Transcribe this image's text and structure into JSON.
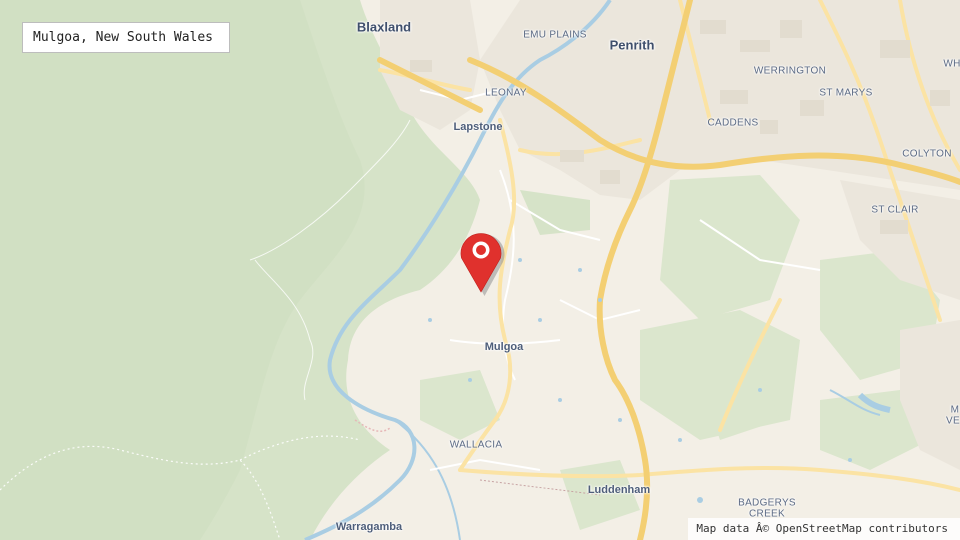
{
  "location": {
    "name": "Mulgoa, New South Wales"
  },
  "map": {
    "colors": {
      "forest": "#d7e3c9",
      "forest_dark": "#cbdcbc",
      "land": "#f3efe6",
      "urban": "#ebe6dc",
      "motorway": "#f5d98a",
      "road": "#fbe8ad",
      "water": "#a9cde3",
      "marker": "#e0312d"
    },
    "places": [
      {
        "id": "blaxland",
        "label": "Blaxland",
        "kind": "major"
      },
      {
        "id": "penrith",
        "label": "Penrith",
        "kind": "major"
      },
      {
        "id": "emu-plains",
        "label": "EMU PLAINS",
        "kind": "suburb"
      },
      {
        "id": "leonay",
        "label": "LEONAY",
        "kind": "suburb"
      },
      {
        "id": "lapstone",
        "label": "Lapstone",
        "kind": "town"
      },
      {
        "id": "werrington",
        "label": "WERRINGTON",
        "kind": "suburb"
      },
      {
        "id": "st-marys",
        "label": "ST MARYS",
        "kind": "suburb"
      },
      {
        "id": "caddens",
        "label": "CADDENS",
        "kind": "suburb"
      },
      {
        "id": "colyton",
        "label": "COLYTON",
        "kind": "suburb"
      },
      {
        "id": "st-clair",
        "label": "ST CLAIR",
        "kind": "suburb"
      },
      {
        "id": "mulgoa",
        "label": "Mulgoa",
        "kind": "town"
      },
      {
        "id": "wallacia",
        "label": "WALLACIA",
        "kind": "suburb"
      },
      {
        "id": "luddenham",
        "label": "Luddenham",
        "kind": "town"
      },
      {
        "id": "warragamba",
        "label": "Warragamba",
        "kind": "town"
      },
      {
        "id": "badgerys-creek-1",
        "label": "BADGERYS",
        "kind": "suburb"
      },
      {
        "id": "badgerys-creek-2",
        "label": "CREEK",
        "kind": "suburb"
      },
      {
        "id": "edge-wh",
        "label": "WH",
        "kind": "suburb"
      },
      {
        "id": "edge-m",
        "label": "M",
        "kind": "suburb"
      },
      {
        "id": "edge-ve",
        "label": "VE",
        "kind": "suburb"
      }
    ]
  },
  "marker": {
    "icon": "map-pin-icon"
  },
  "attribution": "Map data Â© OpenStreetMap contributors"
}
